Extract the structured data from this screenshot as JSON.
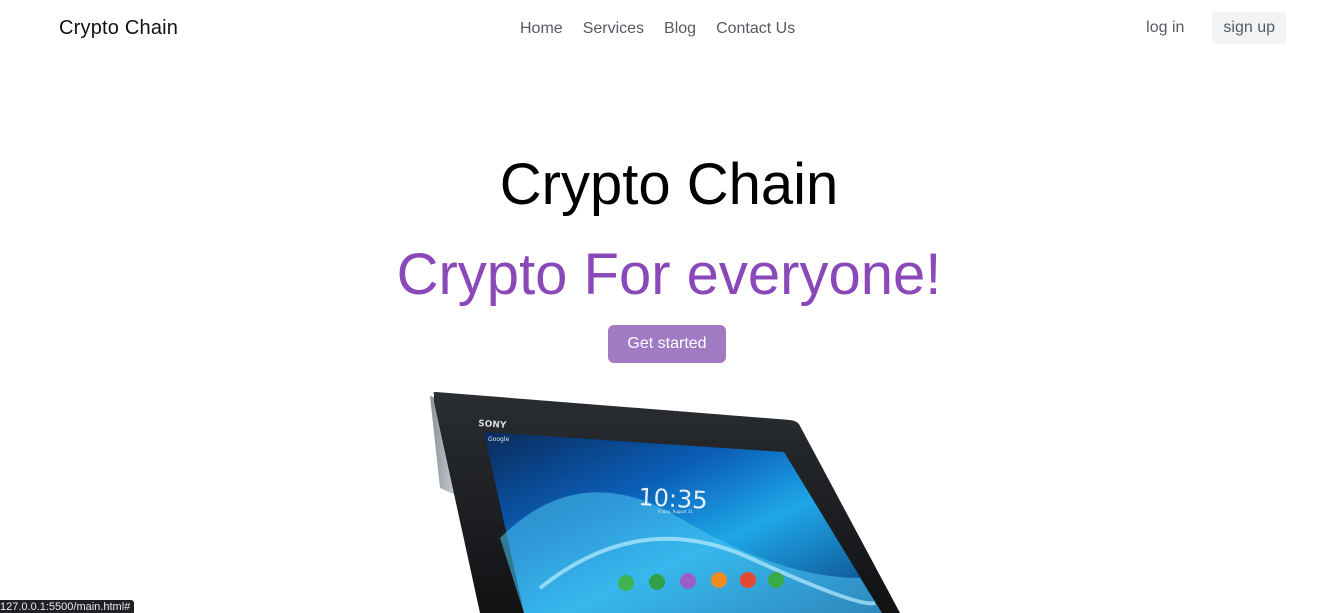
{
  "colors": {
    "accent": "#8a48b8",
    "button_bg": "#a07bc3",
    "nav_text": "#555a60",
    "signup_bg": "#f2f3f5"
  },
  "nav": {
    "brand": "Crypto Chain",
    "links": [
      "Home",
      "Services",
      "Blog",
      "Contact Us"
    ],
    "login": "log in",
    "signup": "sign up"
  },
  "hero": {
    "title": "Crypto Chain",
    "tagline": "Crypto For everyone!",
    "cta": "Get started"
  },
  "device": {
    "brand": "SONY",
    "search_label": "Google",
    "clock": "10:35",
    "date": "Friday, August 31"
  },
  "status_bar": {
    "url": "127.0.0.1:5500/main.html#"
  }
}
